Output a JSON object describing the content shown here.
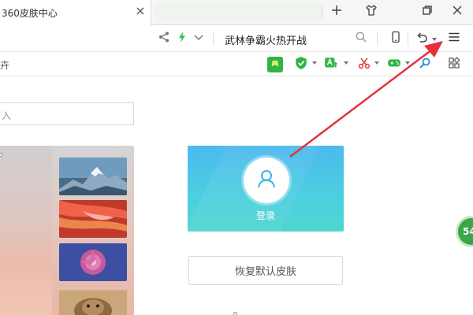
{
  "tab": {
    "title": "360皮肤中心"
  },
  "toolbar": {
    "search_text": "武林争霸火热开战"
  },
  "extbar": {
    "left_text": "卉"
  },
  "content": {
    "skin_search_placeholder": "入",
    "login_label": "登录",
    "restore_label": "恢复默认皮肤",
    "float_badge": "54"
  },
  "colors": {
    "login_card_top": "#4cb9f0",
    "login_card_bottom": "#4fd6cf",
    "annotation_arrow": "#e8303a",
    "bolt": "#2fbe4f"
  },
  "icons": {
    "tab_close": "close-icon",
    "new_tab": "plus-icon",
    "skin": "tshirt-icon",
    "restore_window": "restore-icon",
    "close_window": "close-icon",
    "share": "share-icon",
    "speed": "lightning-icon",
    "dropdown": "chevron-down-icon",
    "search": "search-icon",
    "mobile": "phone-icon",
    "undo": "undo-icon",
    "menu": "hamburger-menu-icon",
    "user": "user-icon"
  }
}
